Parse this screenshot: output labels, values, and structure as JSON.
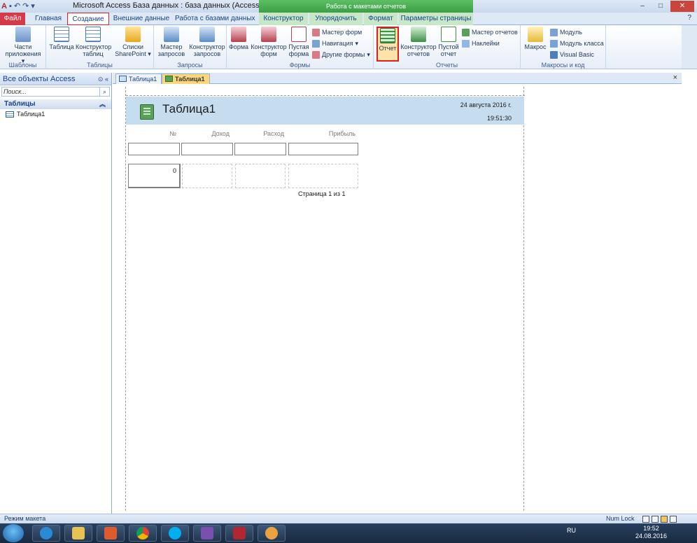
{
  "window": {
    "title": "Microsoft Access База данных : база данных (Access 2007 - 2...",
    "context_tab_group": "Работа с макетами отчетов",
    "min_icon": "minimize-icon",
    "max_icon": "maximize-icon",
    "close_icon": "close-icon"
  },
  "ribbon_tabs": {
    "file": "Файл",
    "home": "Главная",
    "create": "Создание",
    "external": "Внешние данные",
    "database": "Работа с базами данных",
    "design": "Конструктор",
    "arrange": "Упорядочить",
    "format": "Формат",
    "page_setup": "Параметры страницы"
  },
  "ribbon": {
    "templates": {
      "label": "Шаблоны",
      "parts": "Части приложения"
    },
    "tables": {
      "label": "Таблицы",
      "table": "Таблица",
      "table_design": "Конструктор таблиц",
      "sharepoint": "Списки SharePoint"
    },
    "queries": {
      "label": "Запросы",
      "wizard": "Мастер запросов",
      "design": "Конструктор запросов"
    },
    "forms": {
      "label": "Формы",
      "form": "Форма",
      "form_design": "Конструктор форм",
      "blank_form": "Пустая форма",
      "form_wizard": "Мастер форм",
      "navigation": "Навигация",
      "more_forms": "Другие формы"
    },
    "reports": {
      "label": "Отчеты",
      "report": "Отчет",
      "report_design": "Конструктор отчетов",
      "blank_report": "Пустой отчет",
      "report_wizard": "Мастер отчетов",
      "labels": "Наклейки"
    },
    "macros": {
      "label": "Макросы и код",
      "macro": "Макрос",
      "module": "Модуль",
      "class_module": "Модуль класса",
      "vba": "Visual Basic"
    }
  },
  "nav": {
    "header": "Все объекты Access",
    "search_placeholder": "Поиск...",
    "group": "Таблицы",
    "items": [
      "Таблица1"
    ]
  },
  "doc_tabs": [
    "Таблица1",
    "Таблица1"
  ],
  "report": {
    "title": "Таблица1",
    "date": "24 августа 2016 г.",
    "time": "19:51:30",
    "columns": [
      "№",
      "Доход",
      "Расход",
      "Прибыль"
    ],
    "first_value": "0",
    "page_text": "Страница 1 из 1"
  },
  "status": {
    "mode": "Режим макета",
    "numlock": "Num Lock"
  },
  "taskbar": {
    "lang": "RU",
    "time": "19:52",
    "date": "24.08.2016"
  },
  "colors": {
    "file_tab": "#d33b4b",
    "context_green": "#4cae52",
    "report_header": "#c6ddf0",
    "highlight_red": "#e02020"
  }
}
